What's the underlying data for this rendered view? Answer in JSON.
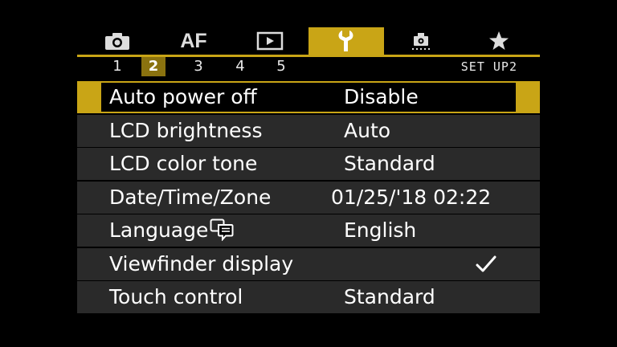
{
  "tabs": [
    {
      "name": "camera-icon",
      "label": "",
      "active": false
    },
    {
      "name": "af-tab",
      "label": "AF",
      "active": false
    },
    {
      "name": "playback-icon",
      "label": "",
      "active": false
    },
    {
      "name": "wrench-icon",
      "label": "",
      "active": true
    },
    {
      "name": "custom-functions-icon",
      "label": "",
      "active": false
    },
    {
      "name": "star-icon",
      "label": "",
      "active": false
    }
  ],
  "pages": [
    "1",
    "2",
    "3",
    "4",
    "5"
  ],
  "active_page": "2",
  "section_label": "SET UP2",
  "menu": [
    {
      "label": "Auto power off",
      "value": "Disable"
    },
    {
      "label": "LCD brightness",
      "value": "Auto"
    },
    {
      "label": "LCD color tone",
      "value": "Standard"
    },
    {
      "label": "Date/Time/Zone",
      "value": "01/25/'18 02:22"
    },
    {
      "label": "Language",
      "value": "English"
    },
    {
      "label": "Viewfinder display",
      "value": ""
    },
    {
      "label": "Touch control",
      "value": "Standard"
    }
  ],
  "colors": {
    "accent": "#c9a516",
    "accent_dark": "#8a720f",
    "row_bg": "#2a2a2a"
  }
}
